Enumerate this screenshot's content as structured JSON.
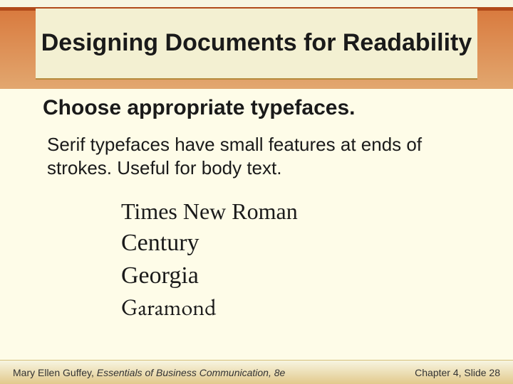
{
  "title": "Designing Documents for Readability",
  "subtitle": "Choose appropriate typefaces.",
  "body": "Serif typefaces have small features at ends of strokes. Useful for body text.",
  "fonts": {
    "f0": "Times New Roman",
    "f1": "Century",
    "f2": "Georgia",
    "f3": "Garamond"
  },
  "footer": {
    "author": "Mary Ellen Guffey, ",
    "book": "Essentials of Business Communication, 8e",
    "chapter": "Chapter 4, Slide 28"
  }
}
